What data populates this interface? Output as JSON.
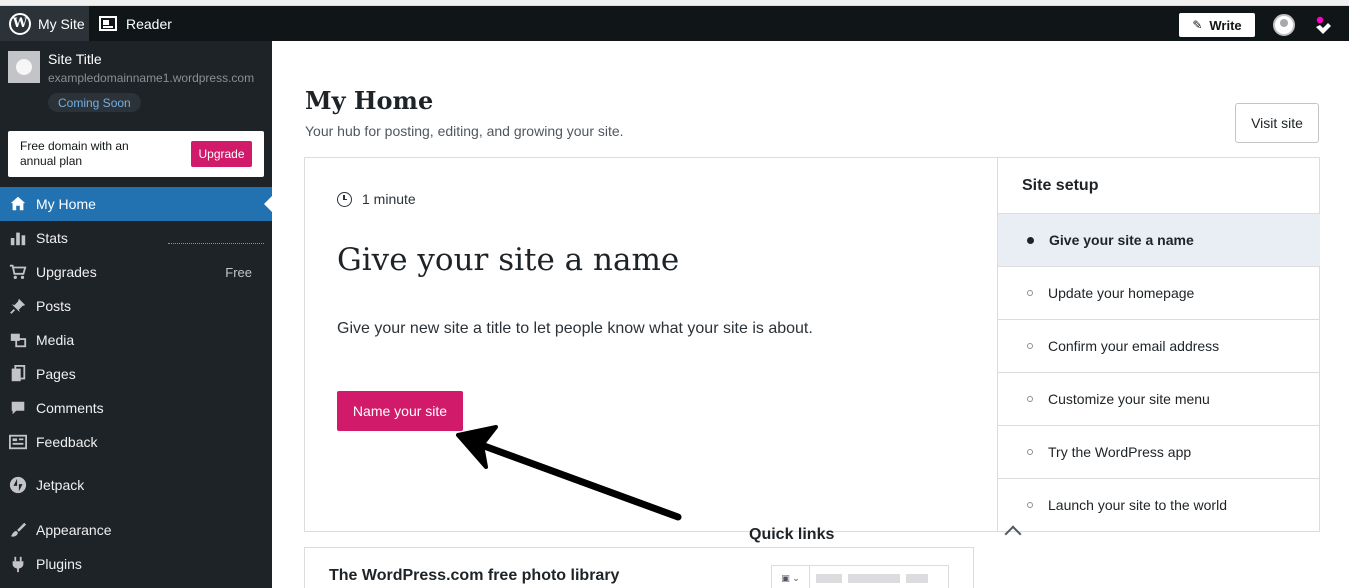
{
  "masterbar": {
    "my_site": "My Site",
    "reader": "Reader",
    "write": "Write"
  },
  "sidebar": {
    "site_title": "Site Title",
    "site_url": "exampledomainname1.wordpress.com",
    "coming_soon": "Coming Soon",
    "upsell_text": "Free domain with an annual plan",
    "upsell_button": "Upgrade",
    "items": [
      {
        "label": "My Home",
        "icon": "home-icon",
        "active": true
      },
      {
        "label": "Stats",
        "icon": "stats-icon"
      },
      {
        "label": "Upgrades",
        "icon": "cart-icon",
        "badge": "Free"
      },
      {
        "label": "Posts",
        "icon": "pin-icon"
      },
      {
        "label": "Media",
        "icon": "media-icon"
      },
      {
        "label": "Pages",
        "icon": "pages-icon"
      },
      {
        "label": "Comments",
        "icon": "comment-icon"
      },
      {
        "label": "Feedback",
        "icon": "feedback-icon"
      },
      {
        "label": "Jetpack",
        "icon": "jetpack-icon"
      },
      {
        "label": "Appearance",
        "icon": "brush-icon"
      },
      {
        "label": "Plugins",
        "icon": "plugin-icon"
      }
    ]
  },
  "main": {
    "title": "My Home",
    "subtitle": "Your hub for posting, editing, and growing your site.",
    "visit_site": "Visit site",
    "task": {
      "time": "1 minute",
      "title": "Give your site a name",
      "description": "Give your new site a title to let people know what your site is about.",
      "button": "Name your site"
    },
    "setup": {
      "heading": "Site setup",
      "items": [
        "Give your site a name",
        "Update your homepage",
        "Confirm your email address",
        "Customize your site menu",
        "Try the WordPress app",
        "Launch your site to the world"
      ]
    },
    "photo_card_title": "The WordPress.com free photo library",
    "quick_links": "Quick links"
  },
  "colors": {
    "accent_pink": "#d11a6a",
    "active_blue": "#2271b1",
    "sidebar_bg": "#1d2327",
    "masterbar_bg": "#101517"
  }
}
